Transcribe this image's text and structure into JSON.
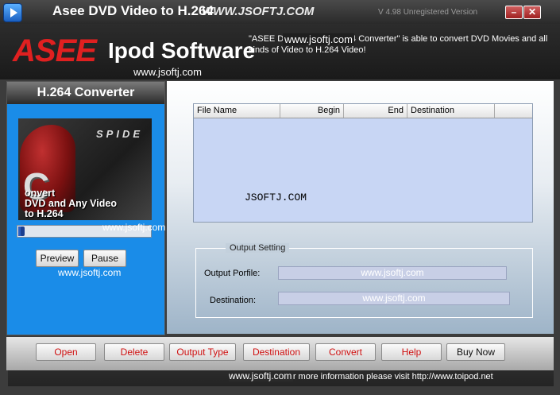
{
  "titlebar": {
    "title": "Asee DVD Video to H.264",
    "title_watermark": "WWW.JSOFTJ.COM",
    "version": "V 4.98 Unregistered Version",
    "minimize_label": "–",
    "close_label": "✕"
  },
  "header": {
    "logo_brand": "ASEE",
    "logo_product": "Ipod Software",
    "logo_url": "www.jsoftj.com",
    "description": "\"ASEE DVD Video to H.264 Converter\" is able to convert DVD Movies and all kinds of  Video to H.264 Video!",
    "description_watermark": "www.jsoftj.com"
  },
  "left_panel": {
    "heading": "H.264 Converter",
    "preview": {
      "title_text": "SPIDE",
      "big_letter": "C",
      "caption": "onvert\nDVD and Any Video\nto H.264"
    },
    "progress_fraction": 0.03,
    "watermark": "www.jsoftj.com",
    "preview_button": "Preview",
    "pause_button": "Pause",
    "watermark2": "www.jsoftj.com"
  },
  "file_list": {
    "columns": [
      "File Name",
      "Begin",
      "End",
      "Destination"
    ],
    "rows": [],
    "watermark": "JSOFTJ.COM"
  },
  "output_setting": {
    "legend": "Output Setting",
    "profile_label": "Output Porfile:",
    "profile_value": "www.jsoftj.com",
    "destination_label": "Destination:",
    "destination_value": "www.jsoftj.com"
  },
  "toolbar": {
    "buttons": [
      "Open",
      "Delete",
      "Output Type",
      "Destination",
      "Convert",
      "Help",
      "Buy Now"
    ]
  },
  "status": {
    "text": "For more information please visit http://www.toipod.net",
    "watermark": "www.jsoftj.com"
  },
  "colors": {
    "accent_red": "#d01010",
    "panel_blue": "#1a8ce8",
    "list_bg": "#c8d6f4"
  }
}
